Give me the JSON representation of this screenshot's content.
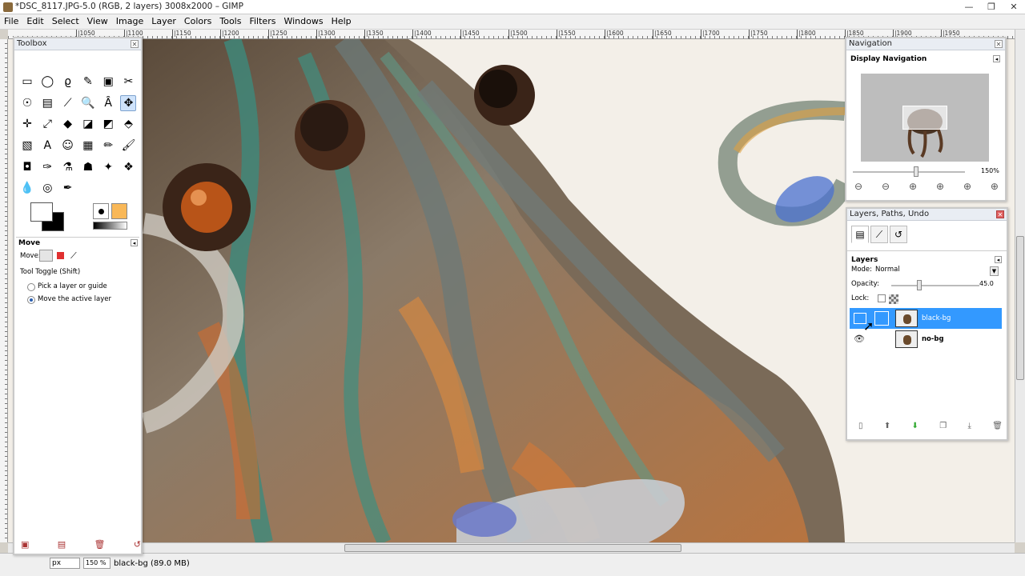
{
  "window": {
    "title": "*DSC_8117.JPG-5.0 (RGB, 2 layers) 3008x2000 – GIMP",
    "controls": [
      "—",
      "❐",
      "✕"
    ]
  },
  "menu": [
    "File",
    "Edit",
    "Select",
    "View",
    "Image",
    "Layer",
    "Colors",
    "Tools",
    "Filters",
    "Windows",
    "Help"
  ],
  "ruler_ticks": [
    "|1050",
    "|1100",
    "|1150",
    "|1200",
    "|1250",
    "|1300",
    "|1350",
    "|1400",
    "|1450",
    "|1500",
    "|1550",
    "|1600",
    "|1650",
    "|1700",
    "|1750",
    "|1800",
    "|1850",
    "|1900",
    "|1950"
  ],
  "toolbox": {
    "title": "Toolbox",
    "tools": [
      "▭",
      "◯",
      "ϱ",
      "✎",
      "▣",
      "✂",
      "☉",
      "▤",
      "⟋",
      "🔍",
      "Ȃ",
      "✥",
      "✛",
      "⤢",
      "◆",
      "◪",
      "◩",
      "⬘",
      "▧",
      "A",
      "☺",
      "▦",
      "✏",
      "🖌",
      "◘",
      "✑",
      "⚗",
      "☗",
      "✦",
      "❖",
      "💧",
      "◎",
      "✒"
    ],
    "options_title": "Move",
    "move_label": "Move:",
    "tool_toggle": "Tool Toggle  (Shift)",
    "radio_1": "Pick a layer or guide",
    "radio_2": "Move the active layer",
    "bottom_icons": [
      "▣",
      "▤",
      "🗑",
      "↺"
    ]
  },
  "navigation": {
    "title": "Navigation",
    "subtitle": "Display Navigation",
    "zoom": "150%",
    "zoom_icons": [
      "⊖",
      "⊖",
      "⊕",
      "⊕",
      "⊕",
      "⊕"
    ]
  },
  "layers_panel": {
    "title": "Layers, Paths, Undo",
    "tab_icons": [
      "▤",
      "⟋",
      "↺"
    ],
    "subtitle": "Layers",
    "mode_label": "Mode:",
    "mode_value": "Normal",
    "opacity_label": "Opacity:",
    "opacity_value": "45.0",
    "lock_label": "Lock:",
    "layers": [
      {
        "name": "black-bg",
        "selected": true
      },
      {
        "name": "no-bg",
        "selected": false
      }
    ],
    "bottom_icons": [
      "▯",
      "⬆",
      "⬇",
      "❐",
      "⤓",
      "🗑"
    ]
  },
  "statusbar": {
    "unit": "px",
    "zoom": "150 %",
    "message": "black-bg (89.0 MB)"
  },
  "colors": {
    "accent_selection": "#3399ff",
    "panel_bg": "#ffffff"
  }
}
